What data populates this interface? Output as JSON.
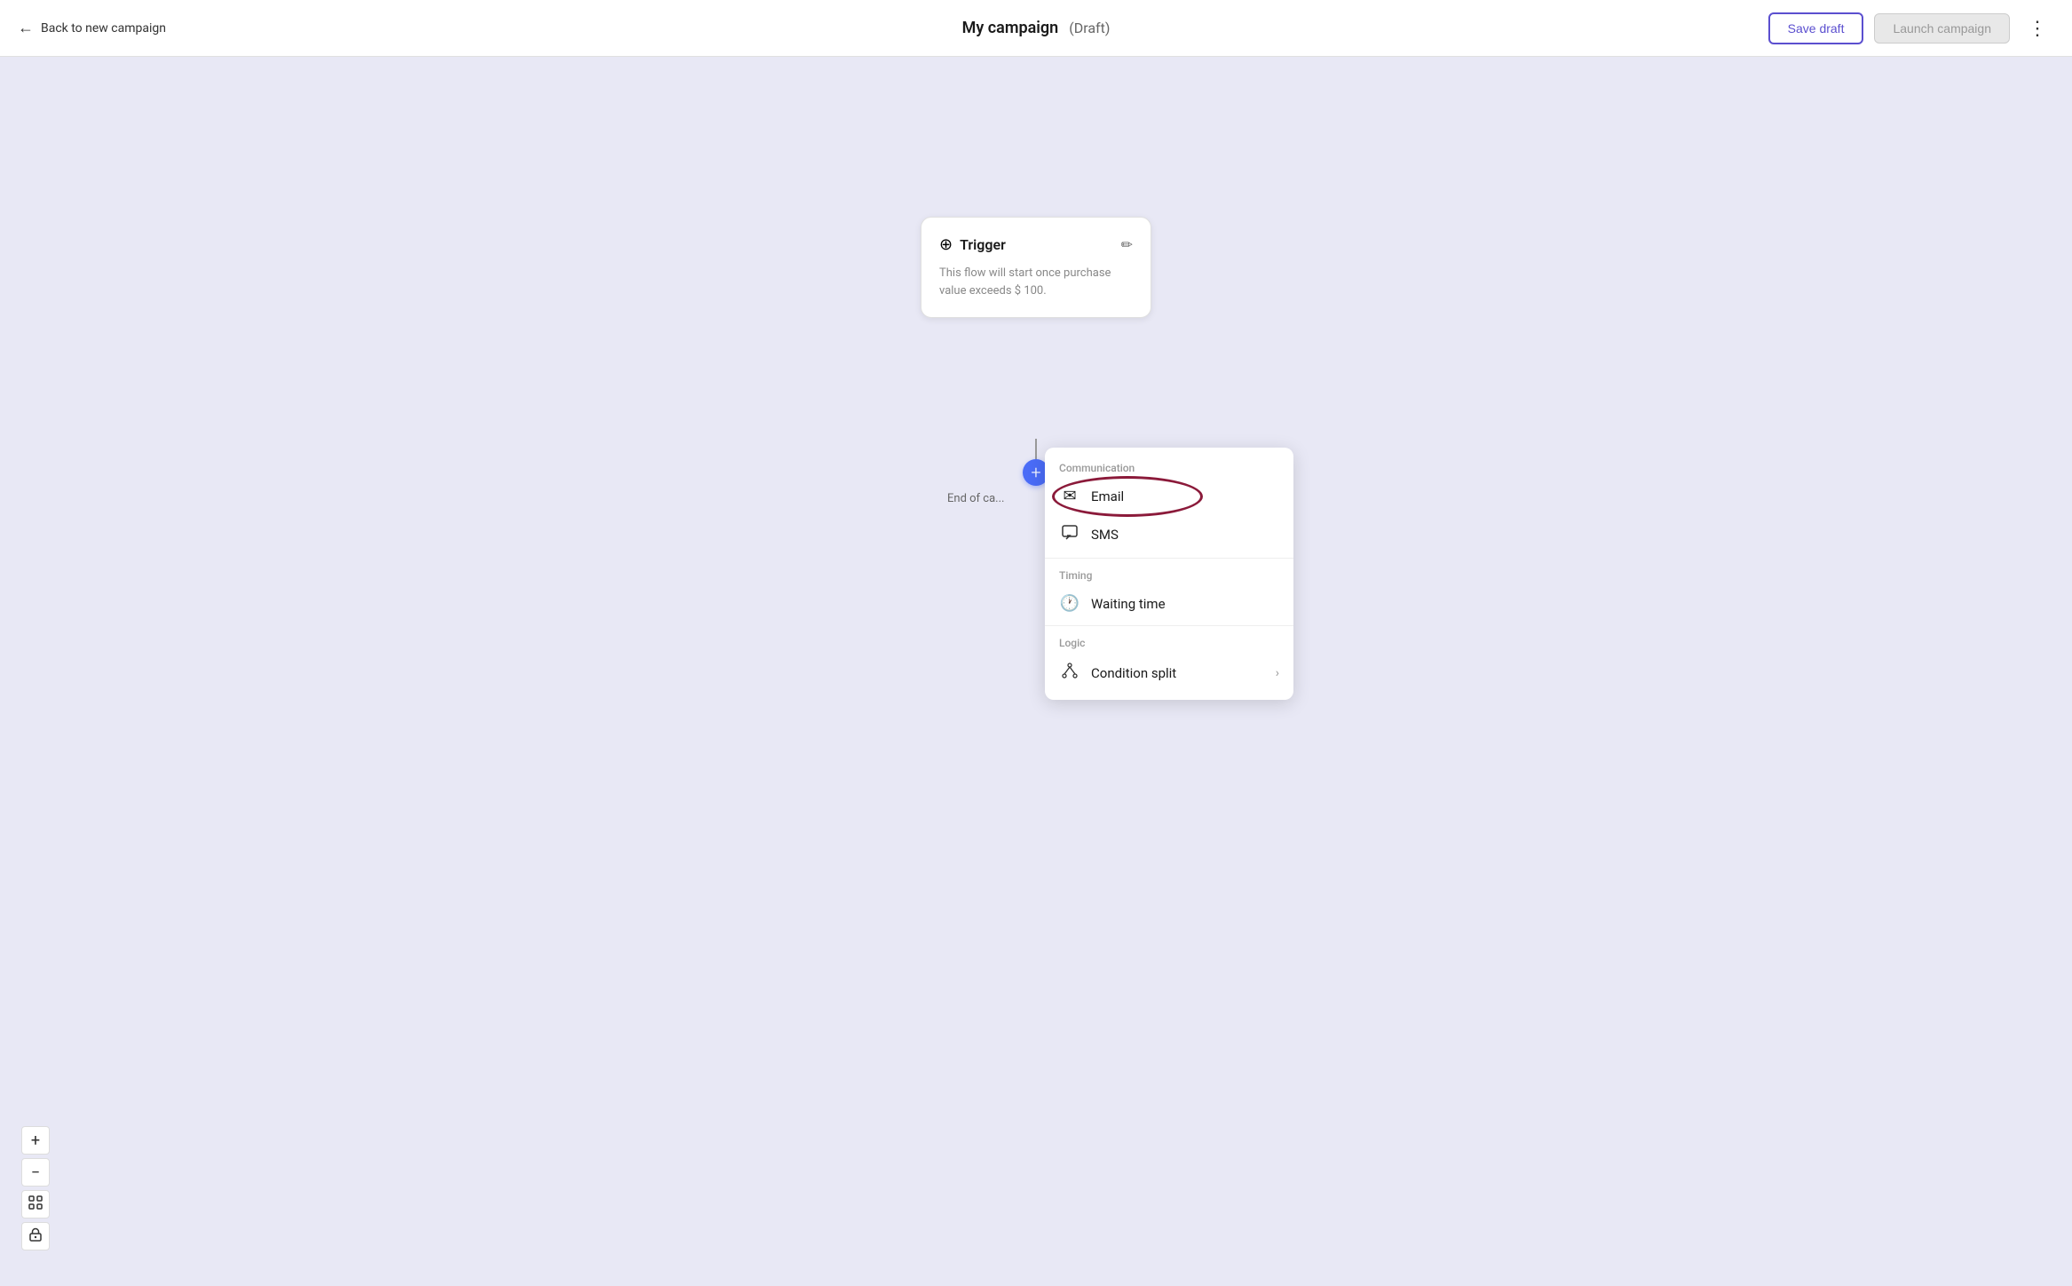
{
  "header": {
    "back_label": "Back to new campaign",
    "campaign_title": "My campaign",
    "draft_label": "(Draft)",
    "save_draft_label": "Save draft",
    "launch_label": "Launch campaign",
    "more_icon": "⋮"
  },
  "canvas": {
    "trigger_card": {
      "title": "Trigger",
      "description": "This flow will start once purchase value exceeds $ 100."
    },
    "plus_icon": "+",
    "end_campaign_label": "End of ca..."
  },
  "dropdown": {
    "communication_label": "Communication",
    "items": [
      {
        "id": "email",
        "label": "Email",
        "icon": "✉",
        "arrow": ""
      },
      {
        "id": "sms",
        "label": "SMS",
        "icon": "💬",
        "arrow": ""
      }
    ],
    "timing_label": "Timing",
    "timing_items": [
      {
        "id": "waiting-time",
        "label": "Waiting time",
        "icon": "🕐",
        "arrow": ""
      }
    ],
    "logic_label": "Logic",
    "logic_items": [
      {
        "id": "condition-split",
        "label": "Condition split",
        "icon": "⛙",
        "arrow": "›"
      }
    ]
  },
  "zoom": {
    "plus_label": "+",
    "minus_label": "−"
  }
}
